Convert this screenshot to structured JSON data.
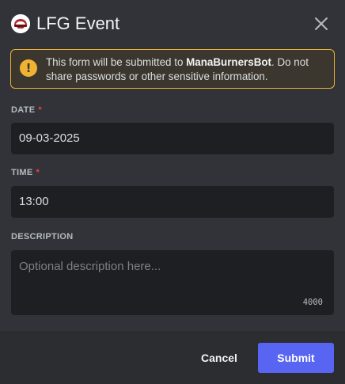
{
  "modal": {
    "title": "LFG Event",
    "app_icon": "mana-burner-avatar-icon",
    "close_icon": "close-icon"
  },
  "notice": {
    "icon": "warning-icon",
    "glyph": "!",
    "prefix": "This form will be submitted to ",
    "bot_name": "ManaBurnersBot",
    "suffix": ". Do not share passwords or other sensitive information."
  },
  "fields": {
    "date": {
      "label": "DATE",
      "required_mark": "*",
      "value": "09-03-2025"
    },
    "time": {
      "label": "TIME",
      "required_mark": "*",
      "value": "13:00"
    },
    "description": {
      "label": "DESCRIPTION",
      "placeholder": "Optional description here...",
      "remaining": "4000"
    }
  },
  "footer": {
    "cancel_label": "Cancel",
    "submit_label": "Submit"
  },
  "colors": {
    "background": "#313338",
    "footer": "#2b2d31",
    "input": "#1e1f22",
    "accent": "#5865f2",
    "warning": "#f0b232",
    "required": "#f23f43"
  }
}
